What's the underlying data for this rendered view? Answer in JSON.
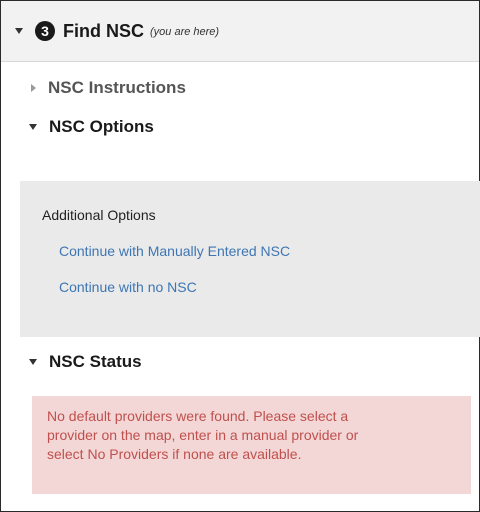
{
  "step": {
    "number": "3",
    "title": "Find NSC",
    "note": "(you are here)"
  },
  "sections": {
    "instructions": {
      "label": "NSC Instructions",
      "expanded": false
    },
    "options": {
      "label": "NSC Options",
      "expanded": true
    },
    "status": {
      "label": "NSC Status",
      "expanded": true
    }
  },
  "additional_options": {
    "title": "Additional Options",
    "links": [
      "Continue with Manually Entered NSC",
      "Continue with no NSC"
    ]
  },
  "status_alert": {
    "lines": [
      "No default providers were found. Please select a",
      "provider on the map, enter in a manual provider or",
      "select No Providers if none are available."
    ]
  },
  "colors": {
    "link": "#3d76b3",
    "alert_background": "#f3d7d7",
    "alert_text": "#c0504d",
    "panel_background": "#eaeaea"
  }
}
